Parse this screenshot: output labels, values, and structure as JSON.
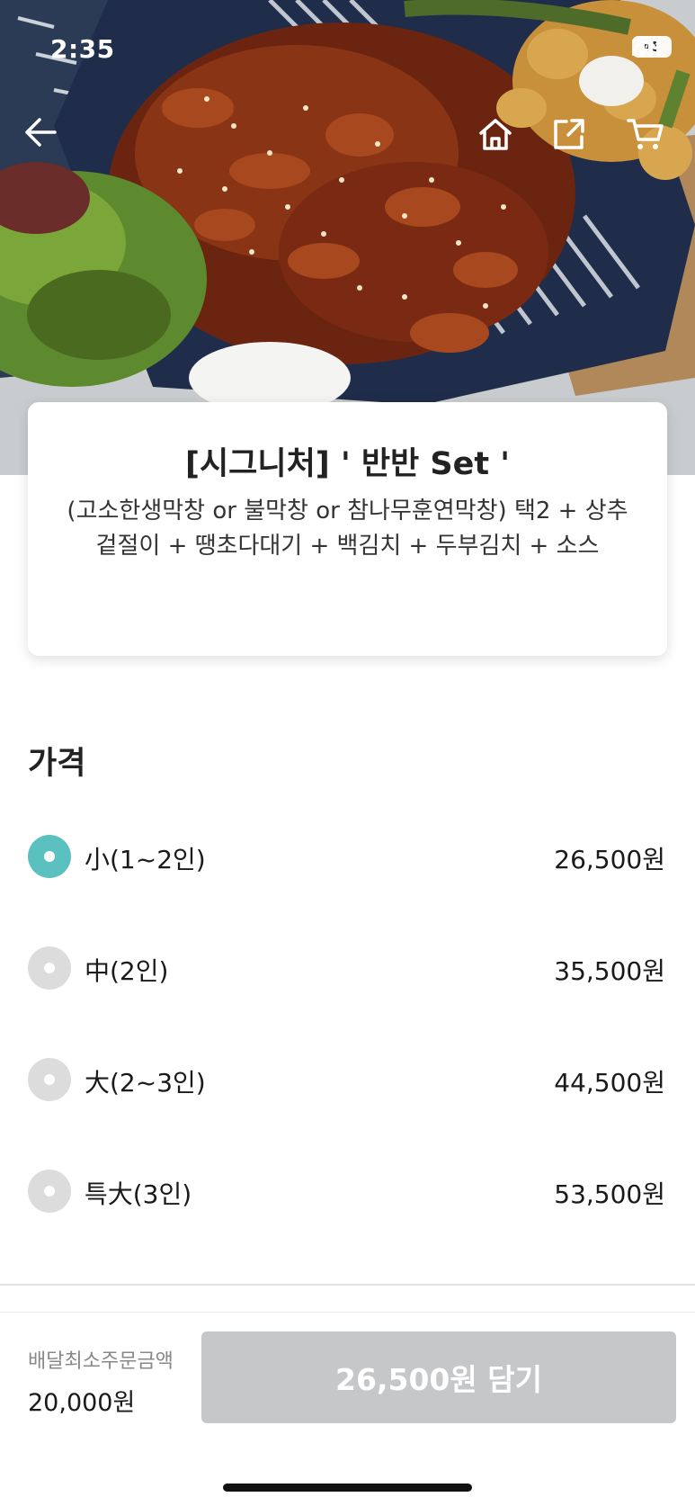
{
  "status_bar": {
    "time": "2:35",
    "battery": "45"
  },
  "nav": {
    "back_icon": "arrow-left-icon",
    "home_icon": "home-icon",
    "share_icon": "share-icon",
    "cart_icon": "cart-icon"
  },
  "product": {
    "title": "[시그니처] ' 반반 Set '",
    "description": "(고소한생막창 or 불막창 or 참나무훈연막창) 택2 + 상추겉절이 + 땡초다대기 + 백김치 + 두부김치 + 소스"
  },
  "price_section": {
    "title": "가격",
    "options": [
      {
        "label": "小(1~2인)",
        "price": "26,500원",
        "selected": true
      },
      {
        "label": "中(2인)",
        "price": "35,500원",
        "selected": false
      },
      {
        "label": "大(2~3인)",
        "price": "44,500원",
        "selected": false
      },
      {
        "label": "특大(3인)",
        "price": "53,500원",
        "selected": false
      }
    ]
  },
  "bottom_bar": {
    "min_order_label": "배달최소주문금액",
    "min_order_value": "20,000원",
    "cart_button_label": "26,500원 담기"
  },
  "colors": {
    "accent_radio": "#5bc1c0",
    "radio_off": "#dcdcdc",
    "cart_button_disabled": "#c6c7c9"
  }
}
